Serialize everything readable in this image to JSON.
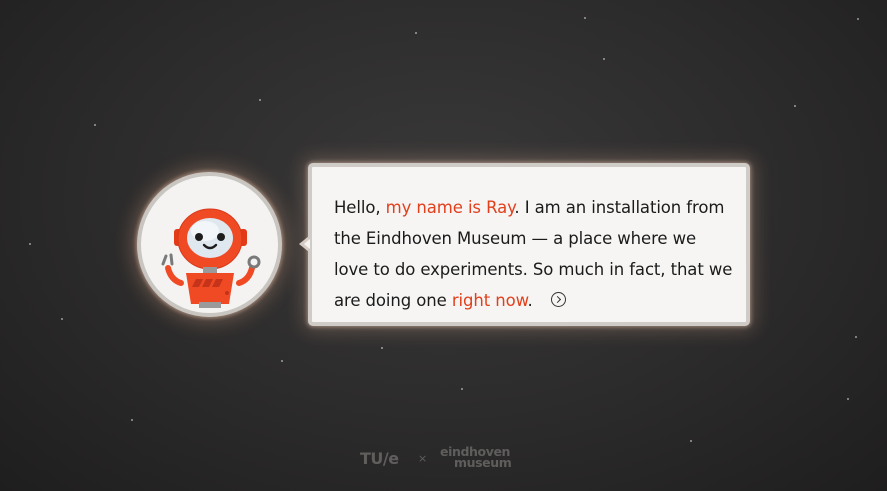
{
  "bubble": {
    "intro": "Hello, ",
    "name_highlight": "my name is Ray",
    "line_rest": ". I am an installation from the Eindhoven Museum — a place where we love to do experiments. So much in fact, that we are doing one ",
    "now_highlight": "right now",
    "end": ".",
    "next_icon": "chevron-right-circle-icon"
  },
  "footer": {
    "tue_logo": "TU/e",
    "separator": "×",
    "museum_logo_line1": "eindhoven",
    "museum_logo_line2": "museum"
  },
  "colors": {
    "highlight": "#e2401c",
    "robot": "#ef4a24",
    "background": "#2c2b2b"
  }
}
